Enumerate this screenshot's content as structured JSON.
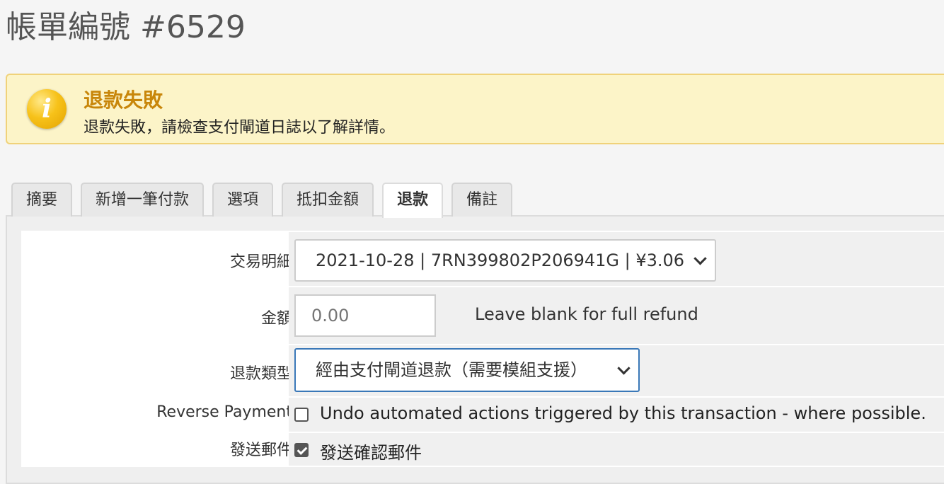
{
  "page": {
    "title": "帳單編號 #6529"
  },
  "alert": {
    "title": "退款失敗",
    "message": "退款失敗，請檢查支付閘道日誌以了解詳情。",
    "icon": "info-icon"
  },
  "tabs": [
    {
      "label": "摘要",
      "active": false
    },
    {
      "label": "新增一筆付款",
      "active": false
    },
    {
      "label": "選項",
      "active": false
    },
    {
      "label": "抵扣金額",
      "active": false
    },
    {
      "label": "退款",
      "active": true
    },
    {
      "label": "備註",
      "active": false
    }
  ],
  "form": {
    "transaction": {
      "label": "交易明細",
      "value": "2021-10-28 | 7RN399802P206941G | ¥3.06"
    },
    "amount": {
      "label": "金額",
      "placeholder": "0.00",
      "value": "",
      "hint": "Leave blank for full refund"
    },
    "refund_type": {
      "label": "退款類型",
      "value": "經由支付閘道退款（需要模組支援）"
    },
    "reverse_payment": {
      "label": "Reverse Payment",
      "checked": false,
      "text": "Undo automated actions triggered by this transaction - where possible."
    },
    "send_email": {
      "label": "發送郵件",
      "checked": true,
      "text": "發送確認郵件"
    }
  },
  "colors": {
    "alert_bg": "#fcf4c8",
    "alert_title": "#c8860a",
    "focus_border": "#3a78b8"
  }
}
